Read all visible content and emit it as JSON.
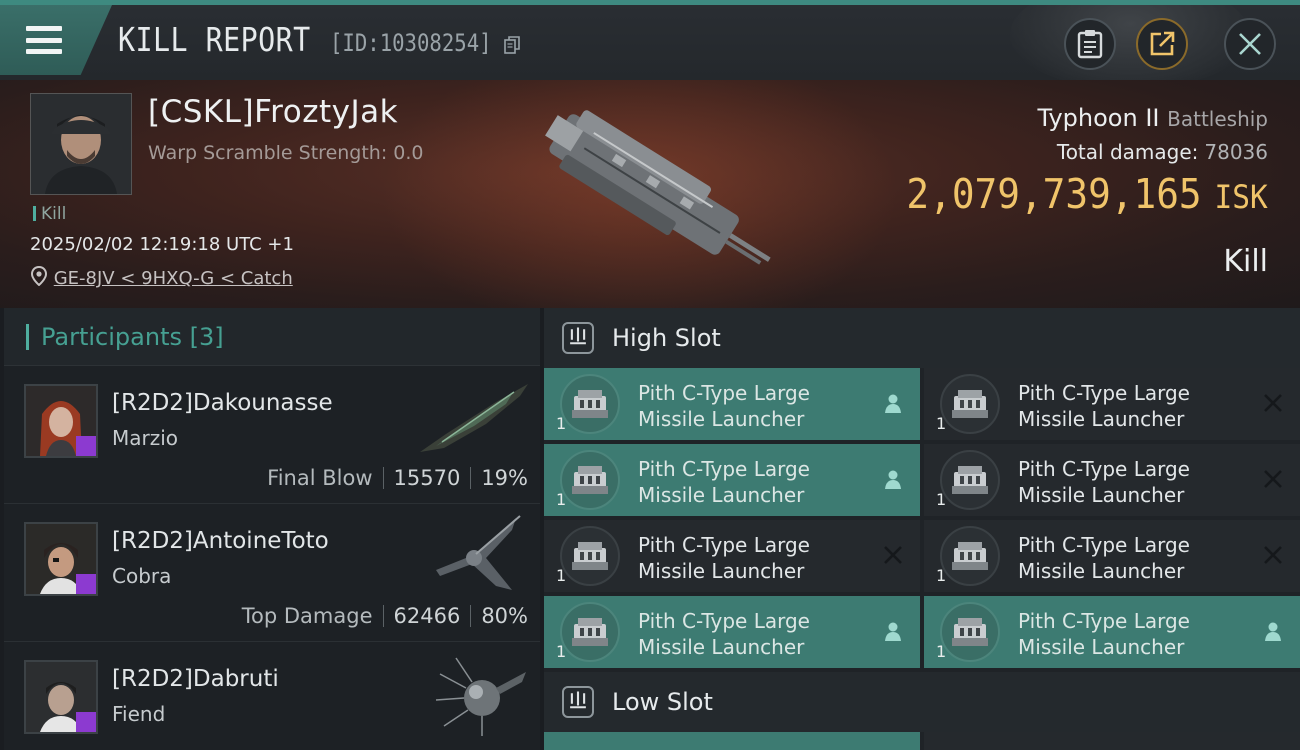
{
  "header": {
    "title": "KILL REPORT",
    "report_id": "[ID:10308254]"
  },
  "victim": {
    "name": "[CSKL]FroztyJak",
    "warp_scramble": "Warp Scramble Strength: 0.0",
    "kill_tag": "Kill",
    "datetime": "2025/02/02 12:19:18 UTC +1",
    "location": "GE-8JV < 9HXQ-G < Catch",
    "ship": "Typhoon II",
    "ship_class": "Battleship",
    "total_damage_label": "Total damage:",
    "total_damage": "78036",
    "isk_value": "2,079,739,165",
    "isk_unit": "ISK",
    "result": "Kill"
  },
  "participants": {
    "heading": "Participants",
    "count": "[3]",
    "items": [
      {
        "name": "[R2D2]Dakounasse",
        "ship": "Marzio",
        "label": "Final Blow",
        "damage": "15570",
        "percent": "19%"
      },
      {
        "name": "[R2D2]AntoineToto",
        "ship": "Cobra",
        "label": "Top Damage",
        "damage": "62466",
        "percent": "80%"
      },
      {
        "name": "[R2D2]Dabruti",
        "ship": "Fiend",
        "label": "",
        "damage": "",
        "percent": ""
      }
    ]
  },
  "slots": {
    "high_label": "High Slot",
    "low_label": "Low Slot",
    "module_line1": "Pith C-Type Large",
    "module_line2": "Missile Launcher",
    "module_qty": "1",
    "high": [
      {
        "status": "dropped"
      },
      {
        "status": "destroyed"
      },
      {
        "status": "dropped"
      },
      {
        "status": "destroyed"
      },
      {
        "status": "destroyed"
      },
      {
        "status": "destroyed"
      },
      {
        "status": "dropped"
      },
      {
        "status": "dropped"
      }
    ]
  },
  "colors": {
    "accent": "#3d7b72",
    "isk": "#f0c46a",
    "participants_heading": "#46a092"
  }
}
